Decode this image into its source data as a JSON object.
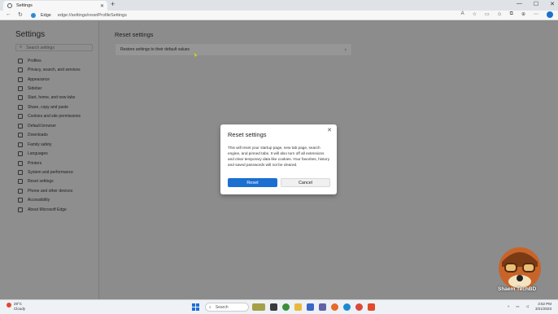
{
  "browser": {
    "tab_title": "Settings",
    "tab_close": "✕",
    "new_tab": "+",
    "window_buttons": [
      "—",
      "☐",
      "✕"
    ],
    "address_label": "Edge",
    "address_url": "edge://settings/resetProfileSettings"
  },
  "sidebar": {
    "heading": "Settings",
    "search_placeholder": "Search settings",
    "items": [
      {
        "label": "Profiles",
        "icon": "profile-icon"
      },
      {
        "label": "Privacy, search, and services",
        "icon": "lock-icon"
      },
      {
        "label": "Appearance",
        "icon": "appearance-icon"
      },
      {
        "label": "Sidebar",
        "icon": "sidebar-icon"
      },
      {
        "label": "Start, home, and new tabs",
        "icon": "home-icon"
      },
      {
        "label": "Share, copy and paste",
        "icon": "share-icon"
      },
      {
        "label": "Cookies and site permissions",
        "icon": "cookie-icon"
      },
      {
        "label": "Default browser",
        "icon": "browser-icon"
      },
      {
        "label": "Downloads",
        "icon": "download-icon"
      },
      {
        "label": "Family safety",
        "icon": "family-icon"
      },
      {
        "label": "Languages",
        "icon": "language-icon"
      },
      {
        "label": "Printers",
        "icon": "printer-icon"
      },
      {
        "label": "System and performance",
        "icon": "system-icon"
      },
      {
        "label": "Reset settings",
        "icon": "reset-icon"
      },
      {
        "label": "Phone and other devices",
        "icon": "phone-icon"
      },
      {
        "label": "Accessibility",
        "icon": "accessibility-icon"
      },
      {
        "label": "About Microsoft Edge",
        "icon": "edge-icon"
      }
    ]
  },
  "main": {
    "heading": "Reset settings",
    "restore_label": "Restore settings to their default values"
  },
  "dialog": {
    "title": "Reset settings",
    "body": "This will reset your startup page, new tab page, search engine, and pinned tabs. It will also turn off all extensions and clear temporary data like cookies. Your favorites, history and saved passwords will not be cleared.",
    "reset_label": "Reset",
    "cancel_label": "Cancel"
  },
  "watermark": {
    "text": "Shaem TechBD"
  },
  "taskbar": {
    "weather_temp": "29°C",
    "weather_desc": "Cloudy",
    "search_label": "Search",
    "time": "3:52 PM",
    "date": "3/21/2023"
  },
  "colors": {
    "accent": "#1a6fd1"
  }
}
